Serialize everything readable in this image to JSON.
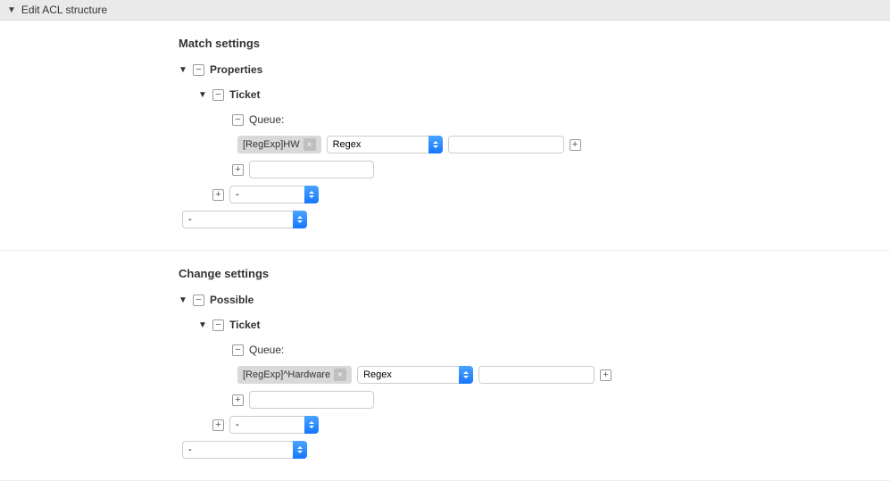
{
  "header": {
    "title": "Edit ACL structure"
  },
  "match": {
    "title": "Match settings",
    "properties_label": "Properties",
    "ticket_label": "Ticket",
    "queue_label": "Queue:",
    "tag_text": "[RegExp]HW",
    "regex_options": [
      "Regex"
    ],
    "regex_selected": "Regex",
    "inner_dash_selected": "-",
    "outer_dash_selected": "-"
  },
  "change": {
    "title": "Change settings",
    "possible_label": "Possible",
    "ticket_label": "Ticket",
    "queue_label": "Queue:",
    "tag_text": "[RegExp]^Hardware",
    "regex_options": [
      "Regex"
    ],
    "regex_selected": "Regex",
    "inner_dash_selected": "-",
    "outer_dash_selected": "-"
  }
}
